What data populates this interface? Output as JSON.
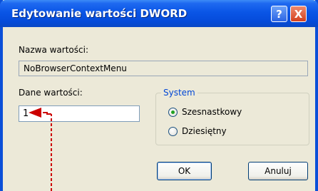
{
  "window": {
    "title": "Edytowanie wartości DWORD"
  },
  "titlebar_buttons": {
    "help": "?",
    "close": "X"
  },
  "value_name": {
    "label": "Nazwa wartości:",
    "value": "NoBrowserContextMenu"
  },
  "value_data": {
    "label": "Dane wartości:",
    "value": "1"
  },
  "system": {
    "title": "System",
    "options": [
      {
        "label": "Szesnastkowy",
        "checked": true
      },
      {
        "label": "Dziesiętny",
        "checked": false
      }
    ]
  },
  "buttons": {
    "ok": "OK",
    "cancel": "Anuluj"
  },
  "annotation": {
    "arrow_color": "#cc0000"
  }
}
